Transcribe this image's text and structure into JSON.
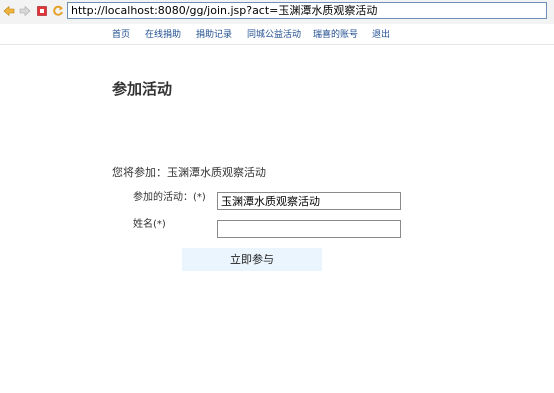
{
  "browser": {
    "url": "http://localhost:8080/gg/join.jsp?act=玉渊潭水质观察活动",
    "icons": [
      "back-arrow-icon",
      "forward-arrow-icon",
      "stop-icon",
      "refresh-icon"
    ]
  },
  "nav": {
    "home": "首页",
    "online_donation": "在线捐助",
    "donation_records": "捐助记录",
    "city_activities": "同城公益活动",
    "my_account": "瑞喜的账号",
    "logout": "退出"
  },
  "page_title": "参加活动",
  "intro": "您将参加：玉渊潭水质观察活动",
  "form": {
    "activity_label": "参加的活动：(*)",
    "activity_value": "玉渊潭水质观察活动",
    "name_label": "姓名(*)",
    "name_value": "",
    "submit_label": "立即参与"
  },
  "colors": {
    "link": "#1f4e8f",
    "button_bg": "#eaf5fd",
    "address_border": "#6d8fb5"
  }
}
